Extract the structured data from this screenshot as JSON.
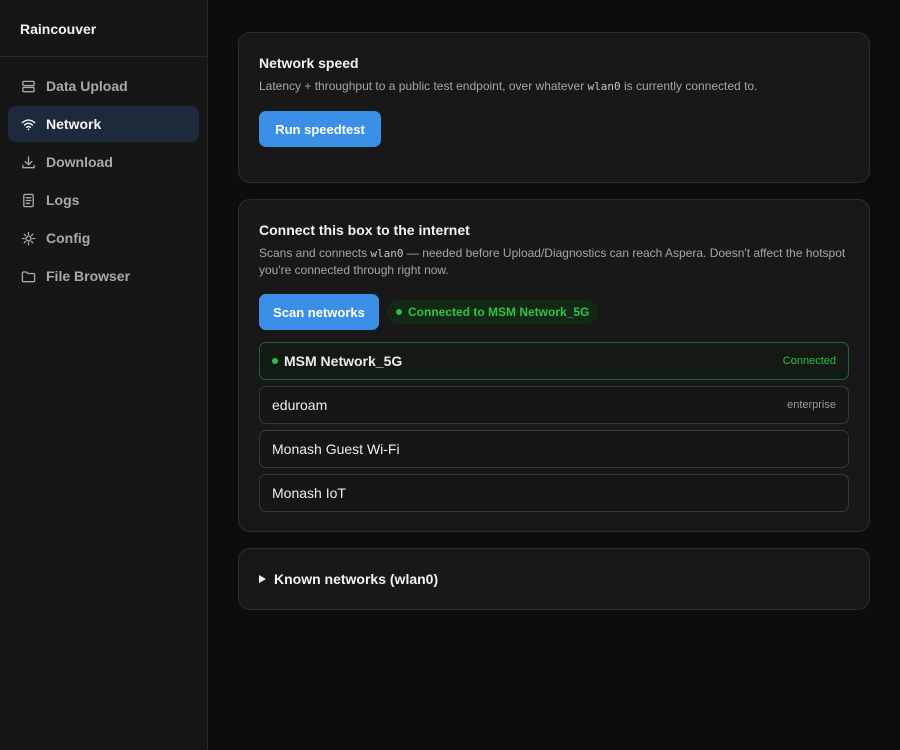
{
  "app": {
    "brand": "Raincouver"
  },
  "sidebar": {
    "items": [
      {
        "label": "Data Upload",
        "icon": "server-icon",
        "active": false
      },
      {
        "label": "Network",
        "icon": "wifi-icon",
        "active": true
      },
      {
        "label": "Download",
        "icon": "download-icon",
        "active": false
      },
      {
        "label": "Logs",
        "icon": "document-icon",
        "active": false
      },
      {
        "label": "Config",
        "icon": "gear-icon",
        "active": false
      },
      {
        "label": "File Browser",
        "icon": "folder-icon",
        "active": false
      }
    ]
  },
  "speed": {
    "title": "Network speed",
    "desc_before": "Latency + throughput to a public test endpoint, over whatever ",
    "desc_code": "wlan0",
    "desc_after": " is currently connected to.",
    "button_label": "Run speedtest"
  },
  "connect": {
    "title": "Connect this box to the internet",
    "desc_before": "Scans and connects ",
    "desc_code": "wlan0",
    "desc_after": " — needed before Upload/Diagnostics can reach Aspera. Doesn't affect the hotspot you're connected through right now.",
    "scan_label": "Scan networks",
    "status_text": "Connected to MSM Network_5G",
    "networks": [
      {
        "name": "MSM Network_5G",
        "meta": "Connected",
        "connected": true
      },
      {
        "name": "eduroam",
        "meta": "enterprise",
        "connected": false
      },
      {
        "name": "Monash Guest Wi-Fi",
        "meta": "",
        "connected": false
      },
      {
        "name": "Monash IoT",
        "meta": "",
        "connected": false
      }
    ]
  },
  "known": {
    "label": "Known networks (wlan0)"
  },
  "colors": {
    "accent": "#3b8fe6",
    "success": "#2fbf45",
    "active_nav_bg": "#1c2a3c"
  }
}
